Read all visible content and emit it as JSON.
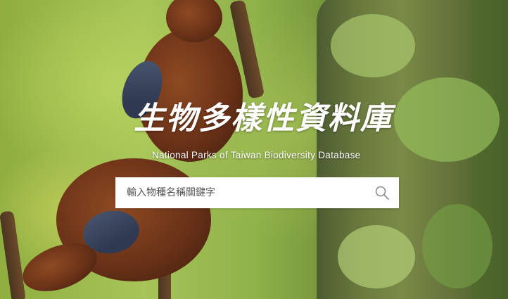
{
  "hero": {
    "title": "生物多樣性資料庫",
    "subtitle": "National Parks of Taiwan Biodiversity Database"
  },
  "search": {
    "placeholder": "輸入物種名稱關鍵字",
    "value": "",
    "button_icon": "search-icon"
  },
  "colors": {
    "background_green": "#8fae40",
    "text_white": "#ffffff",
    "search_box": "#ffffff",
    "icon_gray": "#8a8a8a"
  }
}
